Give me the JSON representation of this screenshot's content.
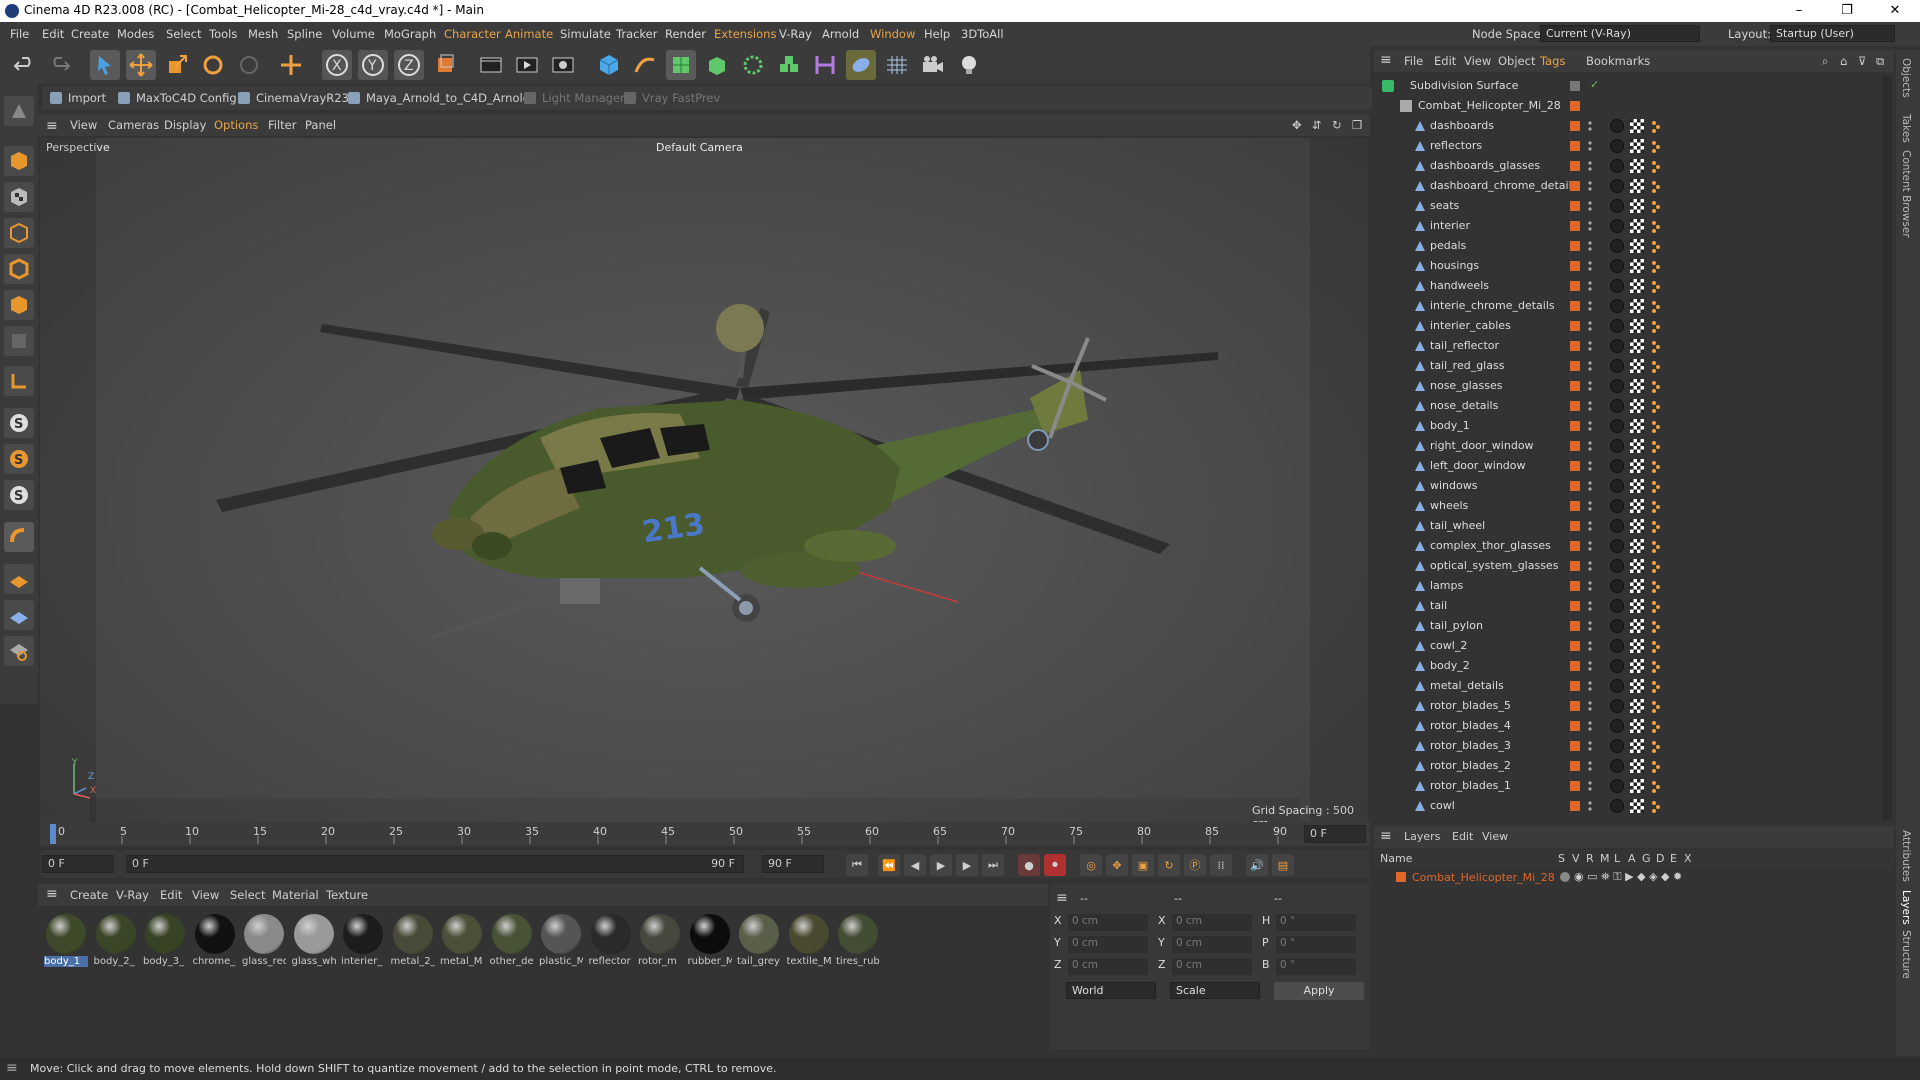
{
  "window": {
    "title": "Cinema 4D R23.008 (RC) - [Combat_Helicopter_Mi-28_c4d_vray.c4d *] - Main",
    "minimize": "–",
    "maximize": "❐",
    "close": "✕"
  },
  "menubar": {
    "items": [
      "File",
      "Edit",
      "Create",
      "Modes",
      "Select",
      "Tools",
      "Mesh",
      "Spline",
      "Volume",
      "MoGraph",
      "Character",
      "Animate",
      "Simulate",
      "Tracker",
      "Render",
      "Extensions",
      "V-Ray",
      "Arnold",
      "Window",
      "Help",
      "3DToAll"
    ],
    "node_space_label": "Node Space:",
    "node_space_value": "Current (V-Ray)",
    "layout_label": "Layout:",
    "layout_value": "Startup (User)"
  },
  "plugins": [
    "Import",
    "MaxToC4D Config",
    "CinemaVrayR23",
    "Maya_Arnold_to_C4D_Arnold",
    "Light Manager",
    "Vray FastPrev"
  ],
  "viewport": {
    "menu": [
      "View",
      "Cameras",
      "Display",
      "Options",
      "Filter",
      "Panel"
    ],
    "name": "Perspective",
    "camera": "Default Camera",
    "grid_spacing": "Grid Spacing : 500 cm",
    "axis_y": "Y",
    "axis_z": "Z",
    "axis_x": "X"
  },
  "timeline": {
    "ticks": [
      "0",
      "5",
      "10",
      "15",
      "20",
      "25",
      "30",
      "35",
      "40",
      "45",
      "50",
      "55",
      "60",
      "65",
      "70",
      "75",
      "80",
      "85",
      "90"
    ],
    "current_frame": "0 F",
    "start_field": "0 F",
    "min_field": "0 F",
    "max_field": "90 F",
    "end_field": "90 F",
    "right_field": "0 F"
  },
  "material_manager": {
    "menu": [
      "Create",
      "V-Ray",
      "Edit",
      "View",
      "Select",
      "Material",
      "Texture"
    ],
    "materials": [
      {
        "label": "body_1",
        "color": "#3e4a2a"
      },
      {
        "label": "body_2_",
        "color": "#3b4628"
      },
      {
        "label": "body_3_",
        "color": "#384326"
      },
      {
        "label": "chrome_",
        "color": "#111111"
      },
      {
        "label": "glass_rec",
        "color": "#8a8a8a"
      },
      {
        "label": "glass_wh",
        "color": "#9a9a9a"
      },
      {
        "label": "interier_",
        "color": "#1c1c1c"
      },
      {
        "label": "metal_2_",
        "color": "#4a4a38"
      },
      {
        "label": "metal_M",
        "color": "#4c5038"
      },
      {
        "label": "other_de",
        "color": "#485236"
      },
      {
        "label": "plastic_M",
        "color": "#555555"
      },
      {
        "label": "reflector",
        "color": "#2a2a2a"
      },
      {
        "label": "rotor_m",
        "color": "#46483e"
      },
      {
        "label": "rubber_M",
        "color": "#0c0c0c"
      },
      {
        "label": "tail_grey",
        "color": "#5a5f4a"
      },
      {
        "label": "textile_M",
        "color": "#4a4a30"
      },
      {
        "label": "tires_rub",
        "color": "#434d34"
      }
    ]
  },
  "coordinates": {
    "header": [
      "--",
      "--",
      "--"
    ],
    "rows": [
      {
        "a": "X",
        "av": "0 cm",
        "b": "X",
        "bv": "0 cm",
        "c": "H",
        "cv": "0 °"
      },
      {
        "a": "Y",
        "av": "0 cm",
        "b": "Y",
        "bv": "0 cm",
        "c": "P",
        "cv": "0 °"
      },
      {
        "a": "Z",
        "av": "0 cm",
        "b": "Z",
        "bv": "0 cm",
        "c": "B",
        "cv": "0 °"
      }
    ],
    "world": "World",
    "scale": "Scale",
    "apply": "Apply"
  },
  "status": "Move: Click and drag to move elements. Hold down SHIFT to quantize movement / add to the selection in point mode, CTRL to remove.",
  "object_manager": {
    "menu": [
      "File",
      "Edit",
      "View",
      "Object",
      "Tags",
      "Bookmarks"
    ],
    "root": "Subdivision Surface",
    "group": "Combat_Helicopter_Mi_28",
    "objects": [
      "dashboards",
      "reflectors",
      "dashboards_glasses",
      "dashboard_chrome_details",
      "seats",
      "interier",
      "pedals",
      "housings",
      "handweels",
      "interie_chrome_details",
      "interier_cables",
      "tail_reflector",
      "tail_red_glass",
      "nose_glasses",
      "nose_details",
      "body_1",
      "right_door_window",
      "left_door_window",
      "windows",
      "wheels",
      "tail_wheel",
      "complex_thor_glasses",
      "optical_system_glasses",
      "lamps",
      "tail",
      "tail_pylon",
      "cowl_2",
      "body_2",
      "metal_details",
      "rotor_blades_5",
      "rotor_blades_4",
      "rotor_blades_3",
      "rotor_blades_2",
      "rotor_blades_1",
      "cowl"
    ]
  },
  "layers": {
    "menu": [
      "Layers",
      "Edit",
      "View"
    ],
    "col_name": "Name",
    "cols": [
      "S",
      "V",
      "R",
      "M",
      "L",
      "A",
      "G",
      "D",
      "E",
      "X"
    ],
    "layer": "Combat_Helicopter_Mi_28"
  },
  "side_tabs": [
    "Objects",
    "Takes",
    "Content Browser",
    "Attributes",
    "Layers",
    "Structure"
  ],
  "colors": {
    "accent_orange": "#e0672a",
    "viewport_bg": "#4b4b4b",
    "panel": "#3b3b3b"
  }
}
